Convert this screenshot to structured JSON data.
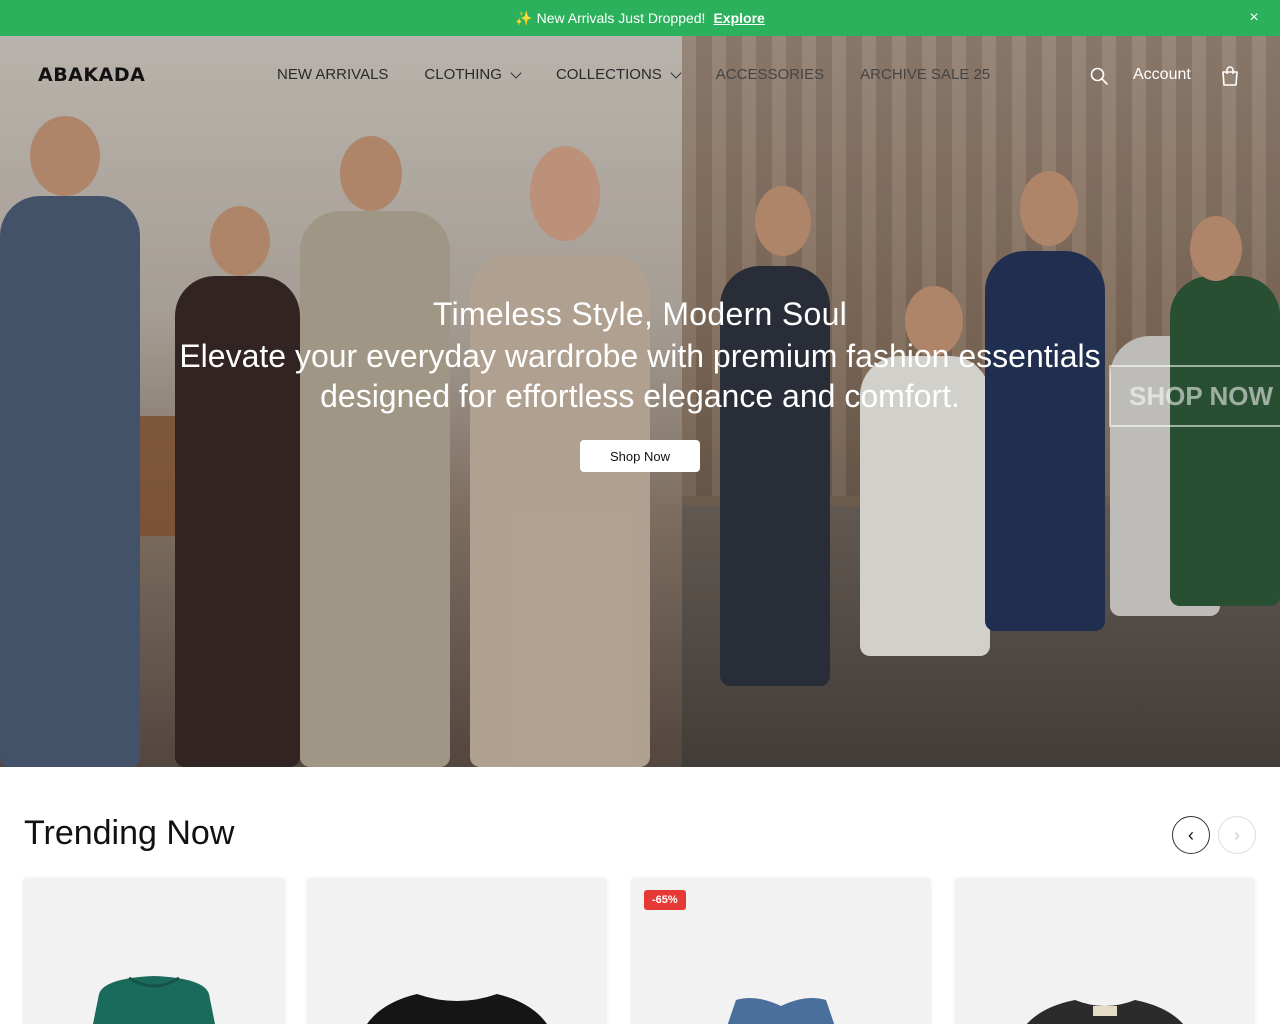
{
  "announcement": {
    "sparkle": "✨",
    "text": "New Arrivals Just Dropped!",
    "link": "Explore",
    "close": "×"
  },
  "header": {
    "logo": "ABAKADA",
    "nav": [
      {
        "label": "NEW ARRIVALS",
        "has_dropdown": false
      },
      {
        "label": "CLOTHING",
        "has_dropdown": true
      },
      {
        "label": "COLLECTIONS",
        "has_dropdown": true
      },
      {
        "label": "ACCESSORIES",
        "has_dropdown": false
      },
      {
        "label": "ARCHIVE SALE 25",
        "has_dropdown": false
      }
    ],
    "account": "Account",
    "icons": [
      "search-icon",
      "bag-icon"
    ]
  },
  "hero": {
    "title": "Timeless Style, Modern Soul",
    "subtitle": "Elevate your everyday wardrobe with premium fashion essentials designed for effortless elegance and comfort.",
    "button": "Shop Now",
    "overlay_label": "SHOP NOW"
  },
  "trending": {
    "title": "Trending Now",
    "prev_arrow": "‹",
    "next_arrow": "›",
    "products": [
      {
        "badge": "",
        "color": "#1b6b5c"
      },
      {
        "badge": "",
        "color": "#151515"
      },
      {
        "badge": "-65%",
        "color": "#4a6f9c"
      },
      {
        "badge": "",
        "color": "#2b2b2b"
      }
    ]
  },
  "colors": {
    "announcement_bg": "#2bb05b",
    "sale_badge": "#e53935"
  }
}
